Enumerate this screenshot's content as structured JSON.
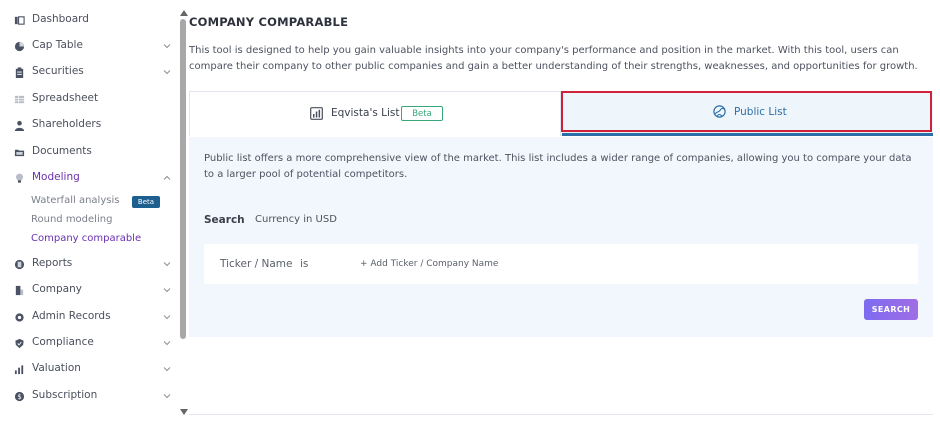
{
  "sidebar": {
    "items": [
      {
        "label": "Dashboard",
        "icon": "dashboard-icon"
      },
      {
        "label": "Cap Table",
        "icon": "pie-chart-icon"
      },
      {
        "label": "Securities",
        "icon": "clipboard-icon"
      },
      {
        "label": "Spreadsheet",
        "icon": "spreadsheet-icon"
      },
      {
        "label": "Shareholders",
        "icon": "person-icon"
      },
      {
        "label": "Documents",
        "icon": "folder-icon"
      },
      {
        "label": "Modeling",
        "icon": "lightbulb-icon"
      },
      {
        "label": "Reports",
        "icon": "reports-icon"
      },
      {
        "label": "Company",
        "icon": "building-icon"
      },
      {
        "label": "Admin Records",
        "icon": "admin-icon"
      },
      {
        "label": "Compliance",
        "icon": "shield-check-icon"
      },
      {
        "label": "Valuation",
        "icon": "bar-chart-icon"
      },
      {
        "label": "Subscription",
        "icon": "dollar-icon"
      }
    ],
    "modeling_sub": [
      {
        "label": "Waterfall analysis"
      },
      {
        "label": "Round modeling"
      },
      {
        "label": "Company comparable"
      }
    ],
    "beta_badge": "Beta",
    "active_color": "#6a2fb0"
  },
  "main": {
    "title": "COMPANY COMPARABLE",
    "intro": "This tool is designed to help you gain valuable insights into your company's performance and position in the market. With this tool, users can compare their company to other public companies and gain a better understanding of their strengths, weaknesses, and opportunities for growth.",
    "tabs": [
      {
        "label": "Eqvista's List",
        "badge": "Beta",
        "icon": "chart-icon"
      },
      {
        "label": "Public List",
        "icon": "globe-icon"
      }
    ],
    "panel_description": "Public list offers a more comprehensive view of the market. This list includes a wider range of companies, allowing you to compare your data to a larger pool of potential competitors.",
    "search_label": "Search",
    "currency_label": "Currency in USD",
    "filter": {
      "field": "Ticker / Name",
      "operator": "is",
      "add_label": "+ Add Ticker / Company Name"
    },
    "search_button": "SEARCH",
    "accent_color": "#2c6fa8",
    "highlight_color": "#d0213a"
  }
}
